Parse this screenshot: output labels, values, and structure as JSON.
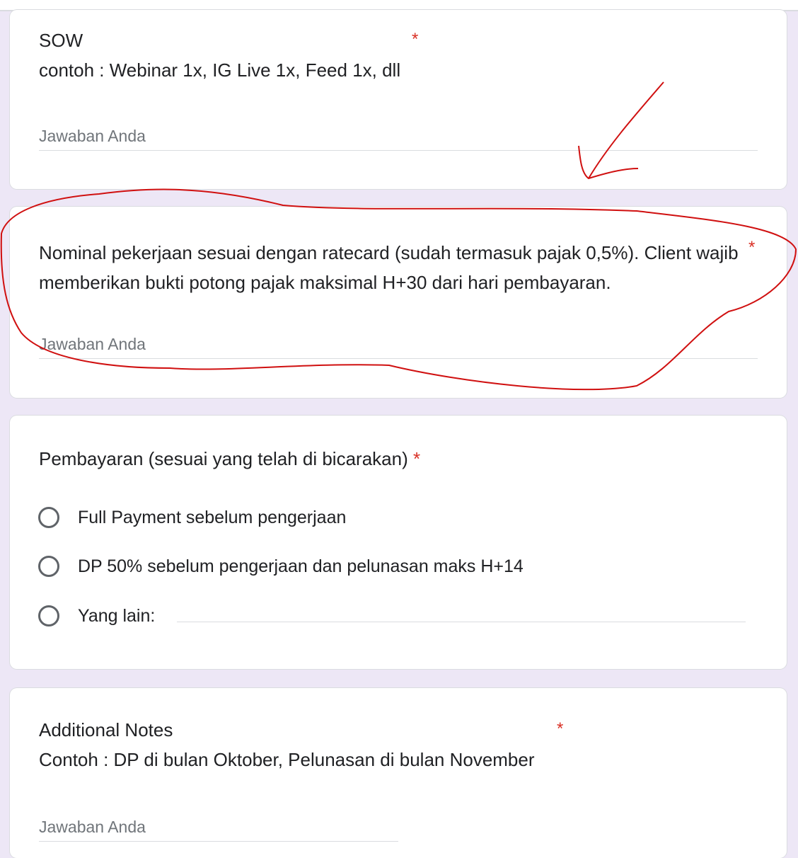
{
  "q1": {
    "title": "SOW",
    "description": "contoh : Webinar 1x, IG Live 1x, Feed 1x, dll",
    "required_mark": "*",
    "answer_placeholder": "Jawaban Anda"
  },
  "q2": {
    "title": "Nominal pekerjaan sesuai dengan ratecard (sudah termasuk pajak 0,5%). Client wajib memberikan bukti potong pajak maksimal H+30 dari hari pembayaran.",
    "required_mark": "*",
    "answer_placeholder": "Jawaban Anda"
  },
  "q3": {
    "title": "Pembayaran (sesuai yang telah di bicarakan)",
    "required_mark": "*",
    "options": [
      "Full Payment sebelum pengerjaan",
      "DP 50% sebelum pengerjaan dan pelunasan maks H+14",
      "Yang lain:"
    ]
  },
  "q4": {
    "title": "Additional Notes",
    "description": "Contoh : DP di bulan Oktober, Pelunasan di bulan November",
    "required_mark": "*",
    "answer_placeholder": "Jawaban Anda"
  },
  "colors": {
    "background": "#ede7f6",
    "required": "#d93025",
    "annotation": "#d01010"
  }
}
